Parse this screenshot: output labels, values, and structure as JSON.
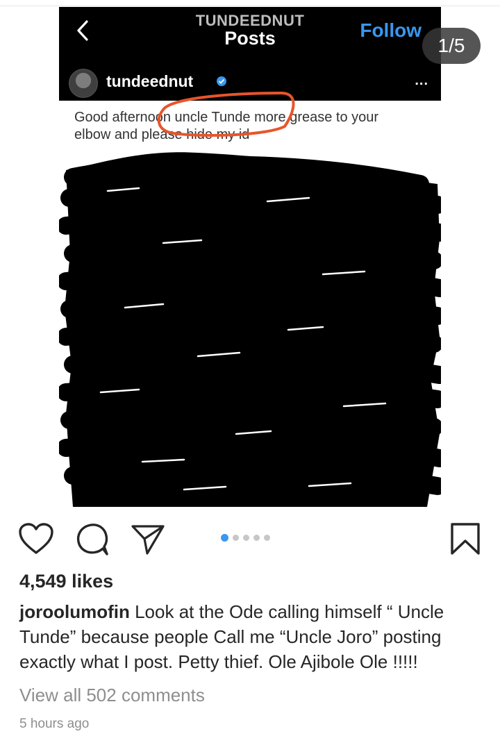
{
  "embedded_post": {
    "header": {
      "username_title": "TUNDEEDNUT",
      "section_title": "Posts",
      "follow_label": "Follow",
      "back_icon": "chevron-left-icon"
    },
    "profile": {
      "handle": "tundeednut",
      "verified_icon": "verified-badge-icon",
      "more_icon": "more-horizontal-icon",
      "more_label": "..."
    },
    "message": {
      "line1": "Good afternoon uncle Tunde more grease to your",
      "line2": "elbow and please hide my id"
    },
    "highlight_color": "#e8552a"
  },
  "page_counter": "1/5",
  "actions": {
    "like_icon": "heart-icon",
    "comment_icon": "comment-icon",
    "share_icon": "share-icon",
    "save_icon": "bookmark-icon",
    "carousel_dots": 5,
    "active_dot": 1,
    "accent_color": "#3897f0"
  },
  "post": {
    "likes": "4,549 likes",
    "caption_user": "joroolumofin",
    "caption_text": "Look at the Ode calling himself “ Uncle Tunde” because people Call me “Uncle Joro” posting exactly what I post. Petty thief. Ole Ajibole Ole !!!!!",
    "view_comments": "View all 502 comments",
    "time_ago": "5 hours ago"
  }
}
